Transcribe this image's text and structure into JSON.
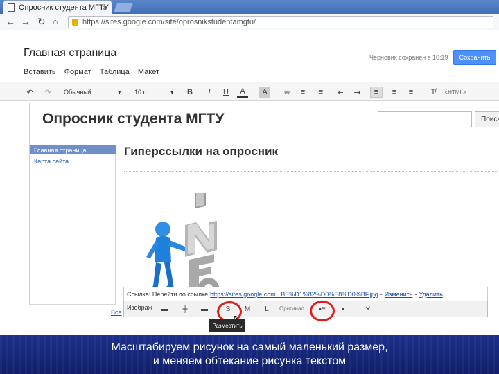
{
  "browser": {
    "tab_title": "Опросник студента МГТУ",
    "url": "https://sites.google.com/site/oprosnikstudentamgtu/",
    "nav": {
      "back": "←",
      "forward": "→",
      "reload": "↻"
    }
  },
  "editor": {
    "page_name": "Главная страница",
    "save_status": "Черновик сохранен в 10:19",
    "save_label": "Сохранить",
    "menu": [
      "Вставить",
      "Формат",
      "Таблица",
      "Макет"
    ],
    "format": {
      "style": "Обычный",
      "size": "10 пт",
      "html_label": "<HTML>"
    }
  },
  "site": {
    "title": "Опросник студента МГТУ",
    "search_button": "Поиск",
    "nav": [
      {
        "label": "Главная страница",
        "active": true
      },
      {
        "label": "Карта сайта",
        "active": false
      }
    ],
    "heading": "Гиперссылки на опросник"
  },
  "link_bubble": {
    "prefix": "Ссылка: Перейти по ссылке",
    "url": "https://sites.google.com...BE%D1%82%D0%E8%D0%BF.jpg",
    "change": "Изменить",
    "remove": "Удалить"
  },
  "image_toolbar": {
    "label": "Изображ",
    "size_small": "S",
    "size_medium": "M",
    "size_large": "L",
    "wrap_label": "Оригинал",
    "tooltip": "Разместить"
  },
  "side_link": "Все",
  "caption": {
    "line1": "Масштабируем рисунок на самый маленький размер,",
    "line2": "и меняем обтекание рисунка текстом"
  }
}
